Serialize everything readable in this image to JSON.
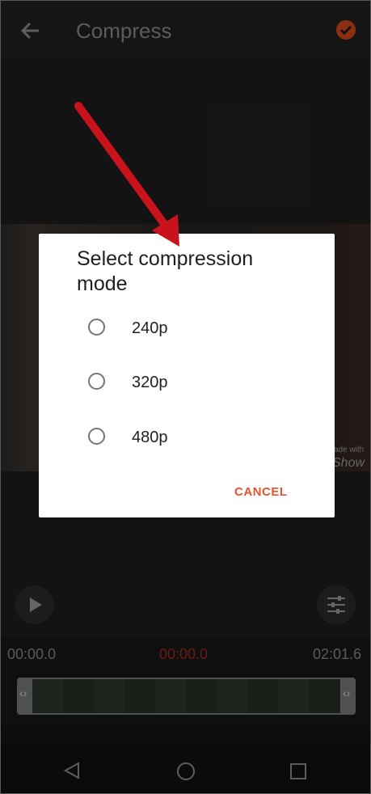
{
  "app_bar": {
    "title": "Compress",
    "back_icon": "arrow-left-icon",
    "confirm_icon": "check-circle-icon",
    "accent": "#d8471f"
  },
  "preview": {
    "watermark_line1": "ade with",
    "watermark_line2": "Show"
  },
  "controls": {
    "play_icon": "play-icon",
    "settings_icon": "sliders-icon"
  },
  "timeline": {
    "start_time": "00:00.0",
    "current_time": "00:00.0",
    "end_time": "02:01.6",
    "left_handle": "‹›",
    "right_handle": "‹›"
  },
  "dialog": {
    "title": "Select compression mode",
    "options": [
      {
        "label": "240p",
        "selected": false
      },
      {
        "label": "320p",
        "selected": false
      },
      {
        "label": "480p",
        "selected": false
      }
    ],
    "cancel_label": "CANCEL",
    "cancel_color": "#e4542e"
  },
  "navbar": {
    "back_icon": "triangle-back-icon",
    "home_icon": "circle-home-icon",
    "recents_icon": "square-recents-icon"
  },
  "annotation": {
    "arrow_color": "#c8131c"
  }
}
